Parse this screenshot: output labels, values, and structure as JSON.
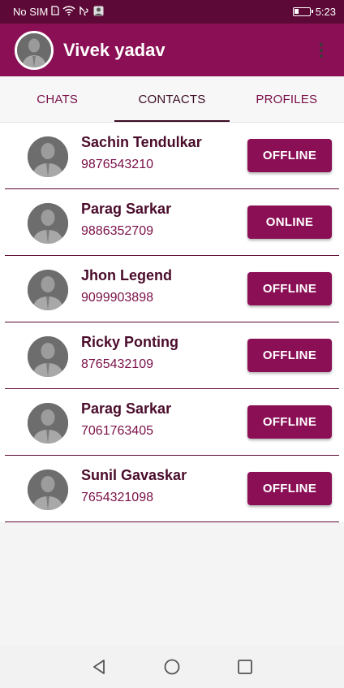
{
  "status_bar": {
    "carrier": "No SIM",
    "time": "5:23",
    "icons": [
      "sim-card-icon",
      "wifi-icon",
      "hotspot-icon",
      "notification-icon",
      "battery-icon"
    ]
  },
  "app_bar": {
    "title": "Vivek yadav",
    "avatar_icon": "person-avatar-icon",
    "menu_icon": "more-vert-icon"
  },
  "tabs": [
    {
      "label": "CHATS",
      "active": false
    },
    {
      "label": "CONTACTS",
      "active": true
    },
    {
      "label": "PROFILES",
      "active": false
    }
  ],
  "contacts": [
    {
      "name": "Sachin Tendulkar",
      "phone": "9876543210",
      "status": "OFFLINE"
    },
    {
      "name": "Parag Sarkar",
      "phone": "9886352709",
      "status": "ONLINE"
    },
    {
      "name": "Jhon Legend",
      "phone": "9099903898",
      "status": "OFFLINE"
    },
    {
      "name": "Ricky Ponting",
      "phone": "8765432109",
      "status": "OFFLINE"
    },
    {
      "name": "Parag Sarkar",
      "phone": "7061763405",
      "status": "OFFLINE"
    },
    {
      "name": "Sunil Gavaskar",
      "phone": "7654321098",
      "status": "OFFLINE"
    }
  ],
  "nav_bar": {
    "back_icon": "back-triangle-icon",
    "home_icon": "home-circle-icon",
    "recents_icon": "recents-square-icon"
  },
  "colors": {
    "primary": "#8b0f55",
    "primary_dark": "#5d0937",
    "text_dark": "#4a0c2b"
  }
}
